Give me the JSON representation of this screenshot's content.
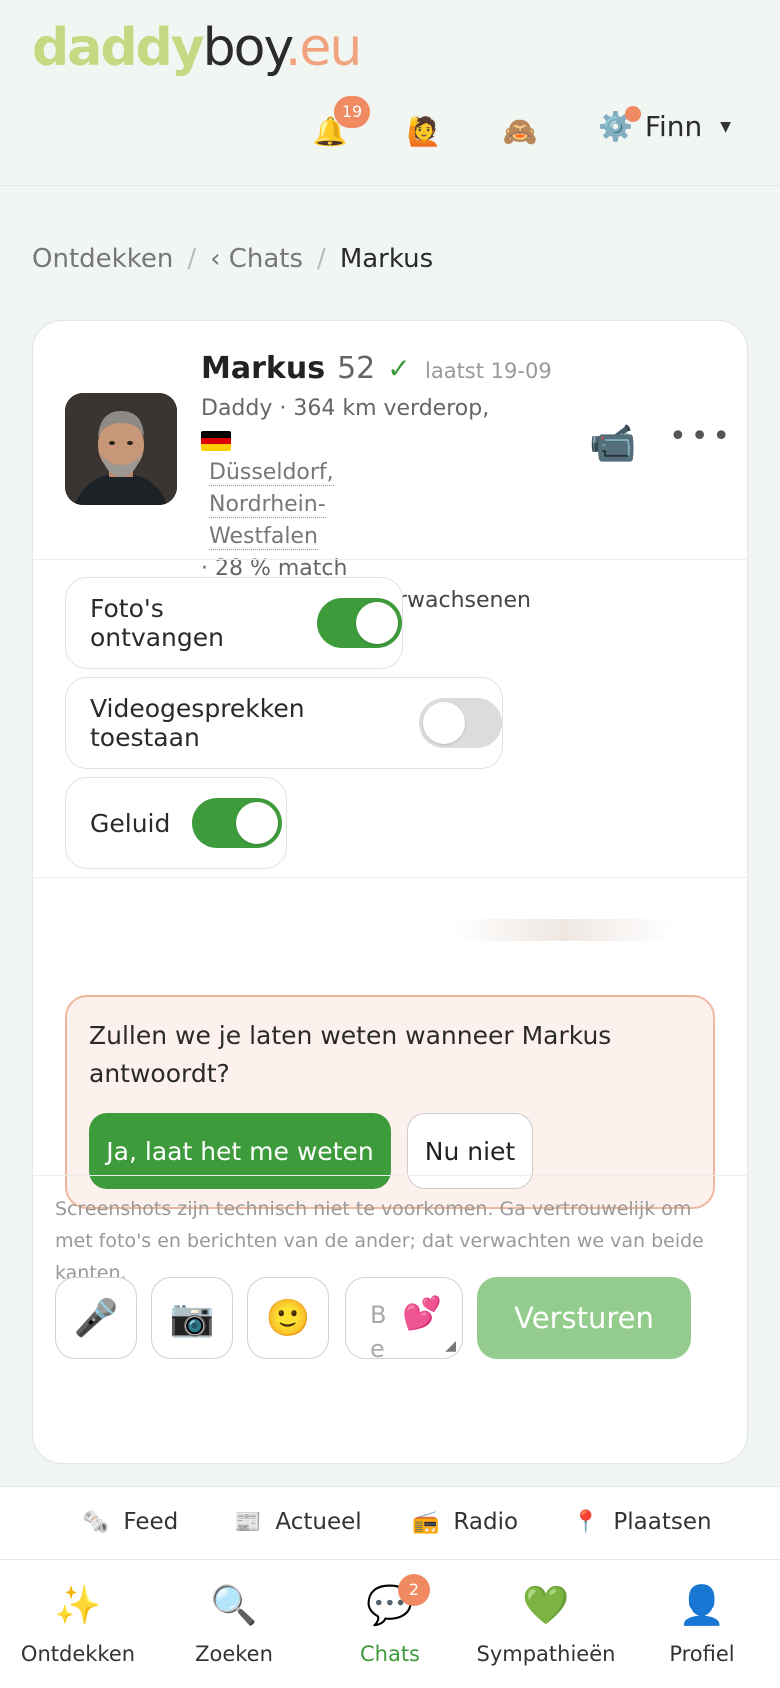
{
  "brand": {
    "part1": "daddy",
    "part2": "boy",
    "part3": ".eu"
  },
  "header": {
    "notifications_count": "19",
    "user_name": "Finn",
    "icons": [
      "bell-icon",
      "face-icon",
      "monkey-icon",
      "gear-icon"
    ]
  },
  "breadcrumb": {
    "item1": "Ontdekken",
    "item2": "‹ Chats",
    "current": "Markus",
    "separator": "/"
  },
  "profile": {
    "name": "Markus",
    "age": "52",
    "verified_mark": "✓",
    "last_seen": "laatst 19-09",
    "line1": "Daddy · 364 km verderop,",
    "location": "Düsseldorf, Nordrhein-Westfalen",
    "match": "· 28 % match",
    "category": "Erwachsene mit Erwachsenen"
  },
  "toggles": [
    {
      "label": "Foto's ontvangen",
      "on": true
    },
    {
      "label": "Videogesprekken toestaan",
      "on": false
    },
    {
      "label": "Geluid",
      "on": true
    }
  ],
  "notify": {
    "question": "Zullen we je laten weten wanneer Markus antwoordt?",
    "yes": "Ja, laat het me weten",
    "no": "Nu niet"
  },
  "composer": {
    "disclaimer": "Screenshots zijn technisch niet te voorkomen. Ga vertrouwelijk om met foto's en berichten van de ander; dat verwachten we van beide kanten.",
    "placeholder": "Be",
    "send": "Versturen"
  },
  "subnav": [
    {
      "label": "Feed",
      "icon": "newspaper-roll-icon"
    },
    {
      "label": "Actueel",
      "icon": "newspaper-icon"
    },
    {
      "label": "Radio",
      "icon": "radio-icon"
    },
    {
      "label": "Plaatsen",
      "icon": "pin-icon"
    }
  ],
  "bottomnav": [
    {
      "label": "Ontdekken",
      "icon": "sparkles-icon"
    },
    {
      "label": "Zoeken",
      "icon": "search-icon"
    },
    {
      "label": "Chats",
      "icon": "chat-icon",
      "badge": "2",
      "active": true
    },
    {
      "label": "Sympathieën",
      "icon": "heart-icon"
    },
    {
      "label": "Profiel",
      "icon": "user-icon"
    }
  ],
  "colors": {
    "accent": "#3e9b3c",
    "badge": "#ef8a62",
    "send_disabled": "#93cc8c"
  }
}
